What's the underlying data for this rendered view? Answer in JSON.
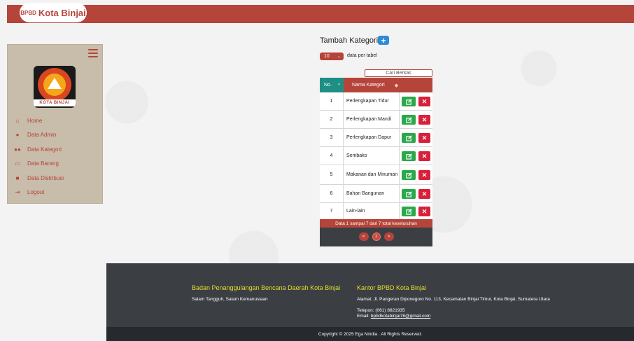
{
  "brand": {
    "small": "BPBD",
    "big": "Kota Binjai"
  },
  "logo": {
    "ribbon_text": "KOTA BINJAI"
  },
  "sidebar": {
    "items": [
      {
        "icon": "home-icon",
        "label": "Home"
      },
      {
        "icon": "user-icon",
        "label": "Data Admin"
      },
      {
        "icon": "users-icon",
        "label": "Data Kategori"
      },
      {
        "icon": "laptop-icon",
        "label": "Data Barang"
      },
      {
        "icon": "truck-icon",
        "label": "Data Distribusi"
      },
      {
        "icon": "logout-icon",
        "label": "Logout"
      }
    ]
  },
  "main": {
    "add_title": "Tambah Kategori",
    "add_button": "+",
    "per_page_value": "10",
    "per_page_label": "data per tabel",
    "search_placeholder": "Cari Berkas",
    "table": {
      "headers": {
        "no": "No.",
        "name": "Nama Kategori"
      },
      "rows": [
        {
          "no": "1",
          "name": "Perlengkapan Tidur"
        },
        {
          "no": "2",
          "name": "Perlengkapan Mandi"
        },
        {
          "no": "3",
          "name": "Perlengkapan Dapur"
        },
        {
          "no": "4",
          "name": "Sembako"
        },
        {
          "no": "5",
          "name": "Makanan dan Minuman"
        },
        {
          "no": "6",
          "name": "Bahan Bangunan"
        },
        {
          "no": "7",
          "name": "Lain-lain"
        }
      ],
      "summary": "Data 1 sampai 7 dari 7 total keseluruhan",
      "pager": {
        "prev": "«",
        "current": "1",
        "next": "»"
      }
    }
  },
  "footer": {
    "left_title": "Badan Penanggulangan Bencana Daerah Kota Binjai",
    "left_text": "Salam Tangguh, Salam Kemanusiaan",
    "right_title": "Kantor BPBD Kota Binjai",
    "address": "Alamat: Jl. Pangeran Diponegoro No. 113, Kecamatan Binjai Timur, Kota Binjai, Sumatera Utara",
    "phone": "Telepon: (061) 8821935",
    "email_label": "Email: ",
    "email": "bpbdkotabinjai76@gmail.com",
    "copyright": "Copyright © 2025 Ega Nindia . All Rights Reserved."
  },
  "colors": {
    "primary": "#b5443a",
    "teal": "#1f8f85",
    "edit": "#2aa84a",
    "delete": "#d9203a",
    "footer": "#3b3f44",
    "footer_title": "#e8dc2a"
  }
}
